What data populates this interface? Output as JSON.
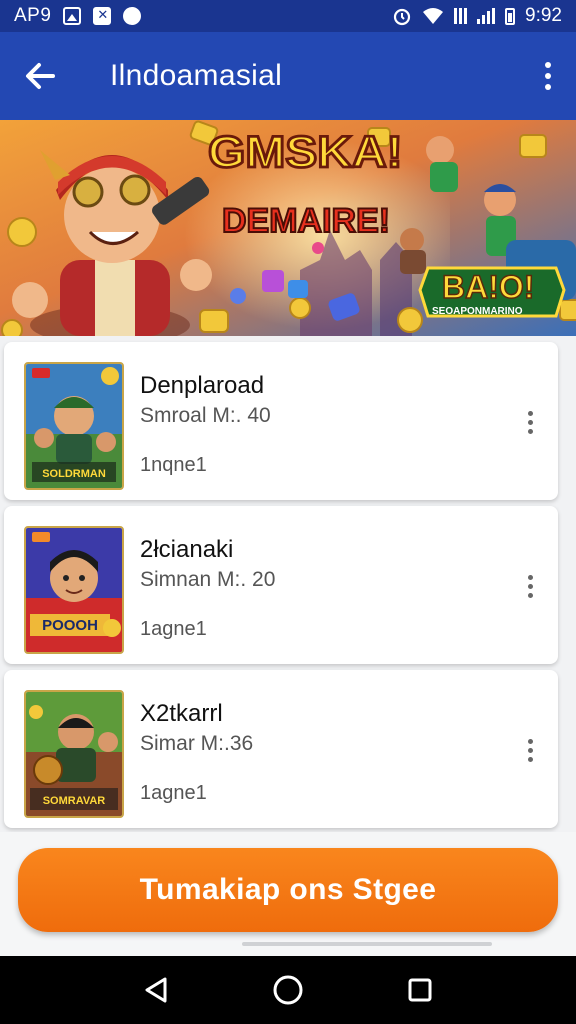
{
  "status_bar": {
    "left_text": "AP9",
    "time": "9:92",
    "icons": [
      "image-icon",
      "x-icon",
      "app-icon",
      "alarm-icon",
      "wifi-icon",
      "signal-icon",
      "signal-icon",
      "battery-icon"
    ]
  },
  "app_bar": {
    "title": "Ilndoamasial",
    "back_icon": "arrow-left-icon",
    "menu_icon": "more-vert-icon"
  },
  "banner": {
    "headline_1": "GMSKA!",
    "headline_2": "DEMAIRE!",
    "badge_title": "BA!O!",
    "badge_sub": "SEOAPONMARINO"
  },
  "items": [
    {
      "name": "Denplaroad",
      "meta": "Smroal M:. 40",
      "size": "1nqne1",
      "thumb_caption": "SOLDRMAN",
      "thumb_bg": "#3c7fbe"
    },
    {
      "name": "2łcianaki",
      "meta": "Simnan M:. 20",
      "size": "1agne1",
      "thumb_caption": "POOOH",
      "thumb_bg": "#cf2b2b"
    },
    {
      "name": "X2tkarrl",
      "meta": "Simar M:.36",
      "size": "1agne1",
      "thumb_caption": "SOMRAVAR",
      "thumb_bg": "#5e9b3a"
    }
  ],
  "cta": {
    "label": "Tumakiap ons Stgee"
  },
  "nav": [
    "back-triangle-icon",
    "home-circle-icon",
    "recents-square-icon"
  ],
  "colors": {
    "app_bar": "#2348b3",
    "status_bar": "#1a3590",
    "cta": "#f57c14",
    "list_bg": "#f1f2f4"
  }
}
